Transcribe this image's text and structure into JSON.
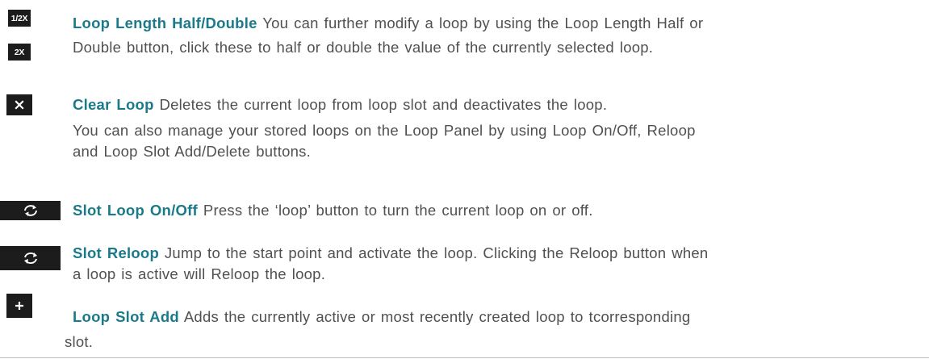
{
  "items": [
    {
      "title": "Loop Length Half/Double",
      "line1": " You can further modify a loop by using the Loop Length Half or",
      "line2": "Double button, click these to half or double the value of the currently selected loop.",
      "icons": {
        "half": "1/2X",
        "double": "2X"
      }
    },
    {
      "title": "Clear Loop",
      "line1": " Deletes the current loop from loop slot and deactivates the loop.",
      "icon": "clear-icon"
    },
    {
      "paragraph_line1": "You can also manage your stored loops on the Loop Panel by using Loop On/Off, Reloop",
      "paragraph_line2": "and Loop Slot Add/Delete buttons."
    },
    {
      "title": "Slot Loop On/Off",
      "line1": " Press the ‘loop’ button to turn the current loop on or off.",
      "icon": "loop-icon"
    },
    {
      "title": "Slot Reloop",
      "line1": " Jump to the start point and activate the loop. Clicking the Reloop button when",
      "line2": "a loop is active will Reloop the loop.",
      "icon": "reloop-icon"
    },
    {
      "title": "Loop Slot Add",
      "line1": " Adds the currently active or most recently created loop to tcorresponding",
      "line2": "slot.",
      "icon": "add-icon"
    }
  ]
}
